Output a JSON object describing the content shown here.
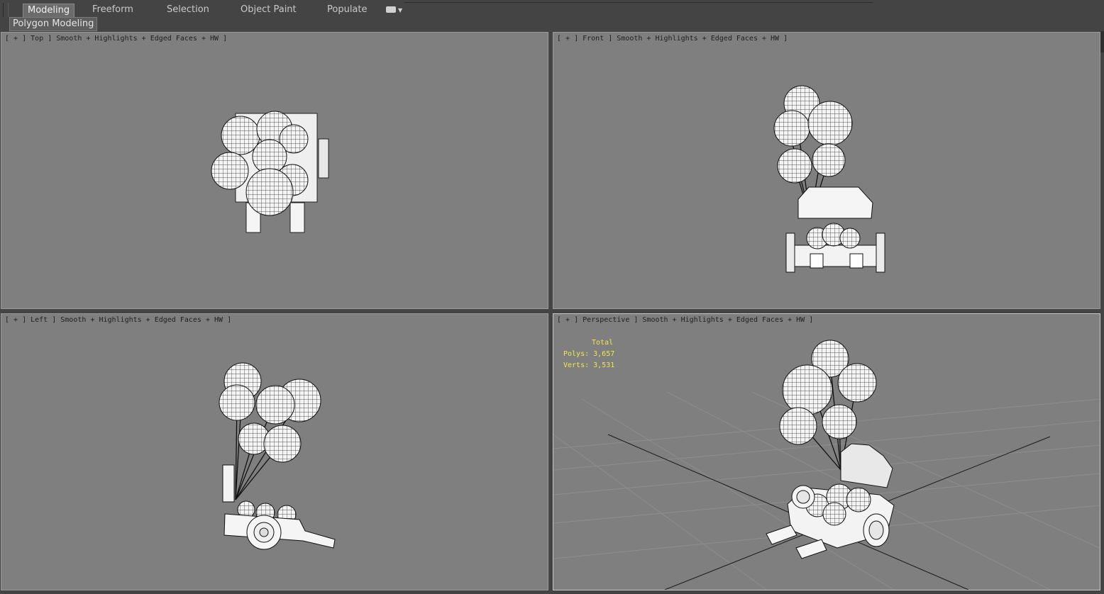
{
  "ribbon": {
    "tabs": [
      {
        "label": "Modeling",
        "active": true
      },
      {
        "label": "Freeform",
        "active": false
      },
      {
        "label": "Selection",
        "active": false
      },
      {
        "label": "Object Paint",
        "active": false
      },
      {
        "label": "Populate",
        "active": false
      }
    ],
    "overflow_icon": "ribbon-toggle-icon",
    "panel_button": "Polygon Modeling"
  },
  "viewports": {
    "top": {
      "label": "[ + ] Top ] Smooth + Highlights + Edged Faces + HW ]"
    },
    "front": {
      "label": "[ + ] Front ] Smooth + Highlights + Edged Faces + HW ]"
    },
    "left": {
      "label": "[ + ] Left ] Smooth + Highlights + Edged Faces + HW ]"
    },
    "perspective": {
      "label": "[ + ] Perspective ] Smooth + Highlights + Edged Faces + HW ]",
      "stats": {
        "title": "Total",
        "polys": "Polys: 3,657",
        "verts": "Verts: 3,531"
      }
    }
  },
  "colors": {
    "viewport_bg": "#7f7f7f",
    "ui_bg": "#444444",
    "stats_text": "#f2e64a",
    "active_border": "#c8c8c8"
  }
}
